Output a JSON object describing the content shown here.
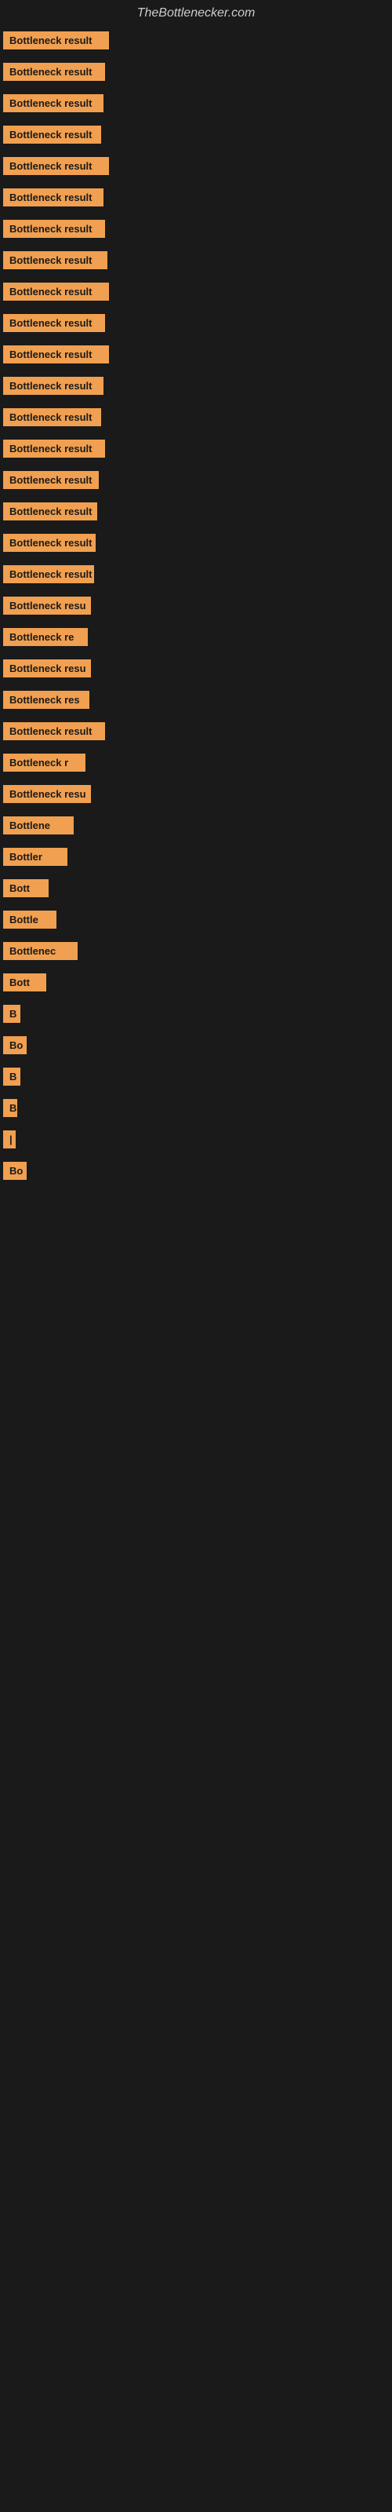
{
  "site": {
    "title": "TheBottlenecker.com"
  },
  "bars": [
    {
      "label": "Bottleneck result",
      "width": 135
    },
    {
      "label": "Bottleneck result",
      "width": 130
    },
    {
      "label": "Bottleneck result",
      "width": 128
    },
    {
      "label": "Bottleneck result",
      "width": 125
    },
    {
      "label": "Bottleneck result",
      "width": 135
    },
    {
      "label": "Bottleneck result",
      "width": 128
    },
    {
      "label": "Bottleneck result",
      "width": 130
    },
    {
      "label": "Bottleneck result",
      "width": 133
    },
    {
      "label": "Bottleneck result",
      "width": 135
    },
    {
      "label": "Bottleneck result",
      "width": 130
    },
    {
      "label": "Bottleneck result",
      "width": 135
    },
    {
      "label": "Bottleneck result",
      "width": 128
    },
    {
      "label": "Bottleneck result",
      "width": 125
    },
    {
      "label": "Bottleneck result",
      "width": 130
    },
    {
      "label": "Bottleneck result",
      "width": 122
    },
    {
      "label": "Bottleneck result",
      "width": 120
    },
    {
      "label": "Bottleneck result",
      "width": 118
    },
    {
      "label": "Bottleneck result",
      "width": 116
    },
    {
      "label": "Bottleneck resu",
      "width": 112
    },
    {
      "label": "Bottleneck re",
      "width": 108
    },
    {
      "label": "Bottleneck resu",
      "width": 112
    },
    {
      "label": "Bottleneck res",
      "width": 110
    },
    {
      "label": "Bottleneck result",
      "width": 130
    },
    {
      "label": "Bottleneck r",
      "width": 105
    },
    {
      "label": "Bottleneck resu",
      "width": 112
    },
    {
      "label": "Bottlene",
      "width": 90
    },
    {
      "label": "Bottler",
      "width": 82
    },
    {
      "label": "Bott",
      "width": 58
    },
    {
      "label": "Bottle",
      "width": 68
    },
    {
      "label": "Bottlenec",
      "width": 95
    },
    {
      "label": "Bott",
      "width": 55
    },
    {
      "label": "B",
      "width": 22
    },
    {
      "label": "Bo",
      "width": 30
    },
    {
      "label": "B",
      "width": 22
    },
    {
      "label": "B",
      "width": 18
    },
    {
      "label": "|",
      "width": 10
    },
    {
      "label": "Bo",
      "width": 30
    }
  ]
}
